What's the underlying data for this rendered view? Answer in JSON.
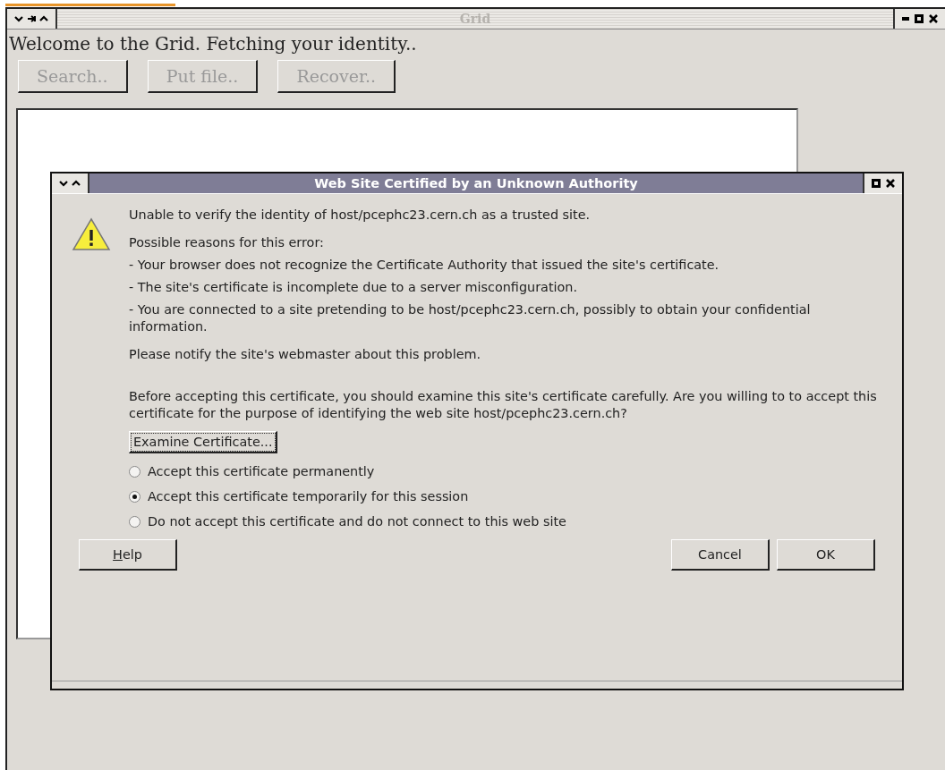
{
  "window": {
    "title": "Grid"
  },
  "welcome": "Welcome to the Grid. Fetching your identity..",
  "toolbar": [
    {
      "label": "Search..",
      "disabled": true
    },
    {
      "label": "Put file..",
      "disabled": true
    },
    {
      "label": "Recover..",
      "disabled": true
    }
  ],
  "dialog": {
    "title": "Web Site Certified by an Unknown Authority",
    "message": "Unable to verify the identity of host/pcephc23.cern.ch as a trusted site.",
    "reasons_heading": "Possible reasons for this error:",
    "reasons": [
      "- Your browser does not recognize the Certificate Authority that issued the site's certificate.",
      "- The site's certificate is incomplete due to a server misconfiguration.",
      "- You are connected to a site pretending to be host/pcephc23.cern.ch, possibly to obtain your confidential information."
    ],
    "notify": "Please notify the site's webmaster about this problem.",
    "question": "Before accepting this certificate, you should examine this site's certificate carefully. Are you willing to to accept this certificate for the purpose of identifying the web site host/pcephc23.cern.ch?",
    "examine_button": {
      "label": "Examine Certificate...",
      "focused": true
    },
    "options": [
      {
        "label": "Accept this certificate permanently",
        "selected": false
      },
      {
        "label": "Accept this certificate temporarily for this session",
        "selected": true
      },
      {
        "label": "Do not accept this certificate and do not connect to this web site",
        "selected": false
      }
    ],
    "help_button": {
      "label": "Help",
      "mnemonic": true
    },
    "buttons": [
      {
        "label": "Cancel"
      },
      {
        "label": "OK"
      }
    ]
  }
}
